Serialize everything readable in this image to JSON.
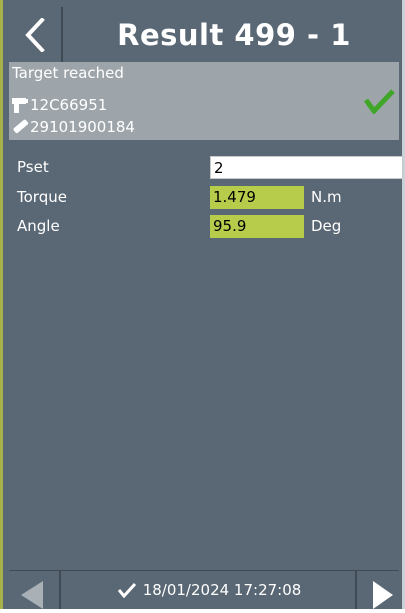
{
  "header": {
    "back_icon": "chevron-left-icon",
    "title": "Result 499 - 1"
  },
  "status": {
    "text": "Target reached",
    "tool_icon": "tool-icon",
    "tool_id": "12C66951",
    "part_icon": "bolt-icon",
    "part_id": "29101900184",
    "result_icon": "checkmark-icon",
    "result_color": "#3fa62a"
  },
  "fields": {
    "pset": {
      "label": "Pset",
      "value": "2",
      "unit": ""
    },
    "torque": {
      "label": "Torque",
      "value": "1.479",
      "unit": "N.m"
    },
    "angle": {
      "label": "Angle",
      "value": "95.9",
      "unit": "Deg"
    }
  },
  "colors": {
    "background": "#5a6774",
    "status_panel": "#9ea5aa",
    "ok_field": "#b8cc4c"
  },
  "footer": {
    "prev_icon": "triangle-left-icon",
    "next_icon": "triangle-right-icon",
    "timestamp_icon": "checkmark-icon",
    "timestamp": "18/01/2024 17:27:08"
  }
}
